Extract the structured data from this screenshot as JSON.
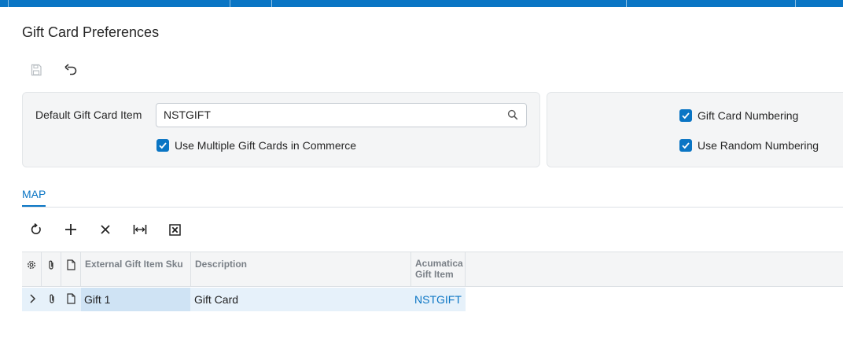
{
  "page": {
    "title": "Gift Card Preferences"
  },
  "toolbar": {
    "save_icon": "save-icon",
    "undo_icon": "undo-icon"
  },
  "form": {
    "default_item_label": "Default Gift Card Item",
    "default_item_value": "NSTGIFT",
    "use_multiple_label": "Use Multiple Gift Cards in Commerce",
    "use_multiple_checked": true,
    "gift_card_numbering_label": "Gift Card Numbering",
    "gift_card_numbering_checked": true,
    "use_random_numbering_label": "Use Random Numbering",
    "use_random_numbering_checked": true
  },
  "tabs": [
    {
      "label": "MAP",
      "active": true
    }
  ],
  "grid_toolbar": {
    "icons": [
      "refresh-icon",
      "add-icon",
      "delete-icon",
      "fit-columns-icon",
      "export-excel-icon"
    ]
  },
  "grid": {
    "columns": {
      "sku": "External Gift Item Sku",
      "description": "Description",
      "item_line1": "Acumatica",
      "item_line2": "Gift Item"
    },
    "rows": [
      {
        "sku": "Gift 1",
        "description": "Gift Card",
        "item": "NSTGIFT"
      }
    ]
  },
  "colors": {
    "accent": "#0a75c4",
    "panel": "#f4f5f6",
    "row_selected": "#e6f1fa"
  }
}
